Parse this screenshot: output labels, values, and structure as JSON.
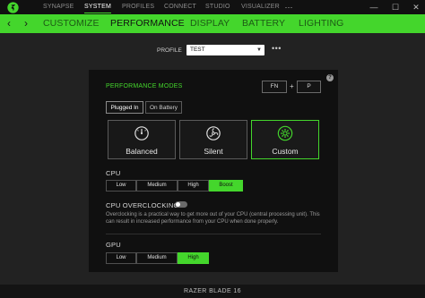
{
  "titlebar": {
    "nav": [
      "SYNAPSE",
      "SYSTEM",
      "PROFILES",
      "CONNECT",
      "STUDIO",
      "VISUALIZER"
    ],
    "active": "SYSTEM",
    "controls": [
      "···",
      "—",
      "☐",
      "✕"
    ]
  },
  "subnav": {
    "back": "‹",
    "forward": "›",
    "tabs": [
      "CUSTOMIZE",
      "PERFORMANCE",
      "DISPLAY",
      "BATTERY",
      "LIGHTING"
    ],
    "active": "PERFORMANCE"
  },
  "profile": {
    "label": "PROFILE",
    "value": "TEST",
    "more": "•••"
  },
  "performance": {
    "title": "PERFORMANCE MODES",
    "help": "?",
    "shortcut": {
      "key1": "FN",
      "plus": "+",
      "key2": "P"
    },
    "subtabs": [
      "Plugged In",
      "On Battery"
    ],
    "active_subtab": "Plugged In",
    "modes": [
      {
        "label": "Balanced",
        "icon": "gauge-icon"
      },
      {
        "label": "Silent",
        "icon": "fan-icon"
      },
      {
        "label": "Custom",
        "icon": "gear-icon"
      }
    ],
    "active_mode": "Custom",
    "cpu": {
      "label": "CPU",
      "options": [
        "Low",
        "Medium",
        "High",
        "Boost"
      ],
      "selected": "Boost"
    },
    "overclocking": {
      "label": "CPU OVERCLOCKING",
      "enabled": false,
      "description": "Overclocking is a practical way to get more out of your CPU (central processing unit). This can result in increased performance from your CPU when done properly."
    },
    "gpu": {
      "label": "GPU",
      "options": [
        "Low",
        "Medium",
        "High"
      ],
      "selected": "High"
    }
  },
  "device": {
    "name": "RAZER BLADE 16"
  },
  "colors": {
    "accent": "#44d62c",
    "background": "#222222",
    "panel": "#101010"
  }
}
